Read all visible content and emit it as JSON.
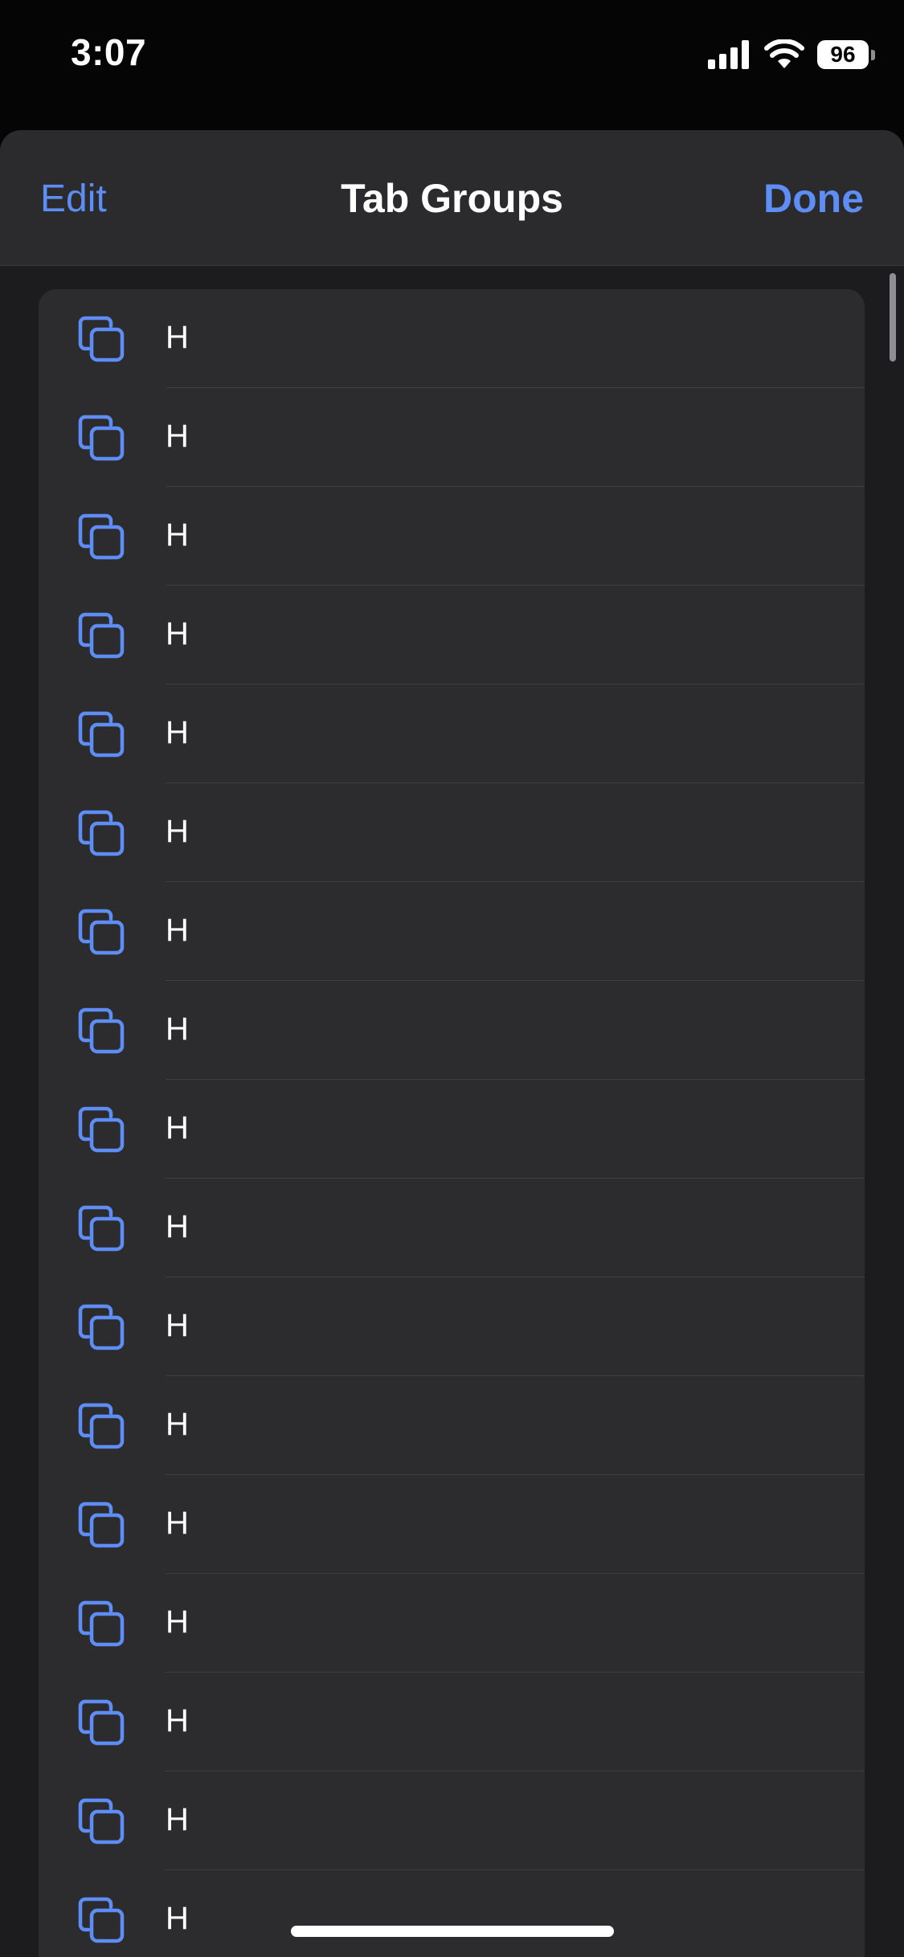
{
  "status_bar": {
    "time": "3:07",
    "battery_level": "96"
  },
  "nav": {
    "edit_label": "Edit",
    "title": "Tab Groups",
    "done_label": "Done"
  },
  "accent_color": "#5e8ef5",
  "row_icon": "tab-group-icon",
  "rows": [
    {
      "label": "H"
    },
    {
      "label": "H"
    },
    {
      "label": "H"
    },
    {
      "label": "H"
    },
    {
      "label": "H"
    },
    {
      "label": "H"
    },
    {
      "label": "H"
    },
    {
      "label": "H"
    },
    {
      "label": "H"
    },
    {
      "label": "H"
    },
    {
      "label": "H"
    },
    {
      "label": "H"
    },
    {
      "label": "H"
    },
    {
      "label": "H"
    },
    {
      "label": "H"
    },
    {
      "label": "H"
    },
    {
      "label": "H"
    }
  ]
}
